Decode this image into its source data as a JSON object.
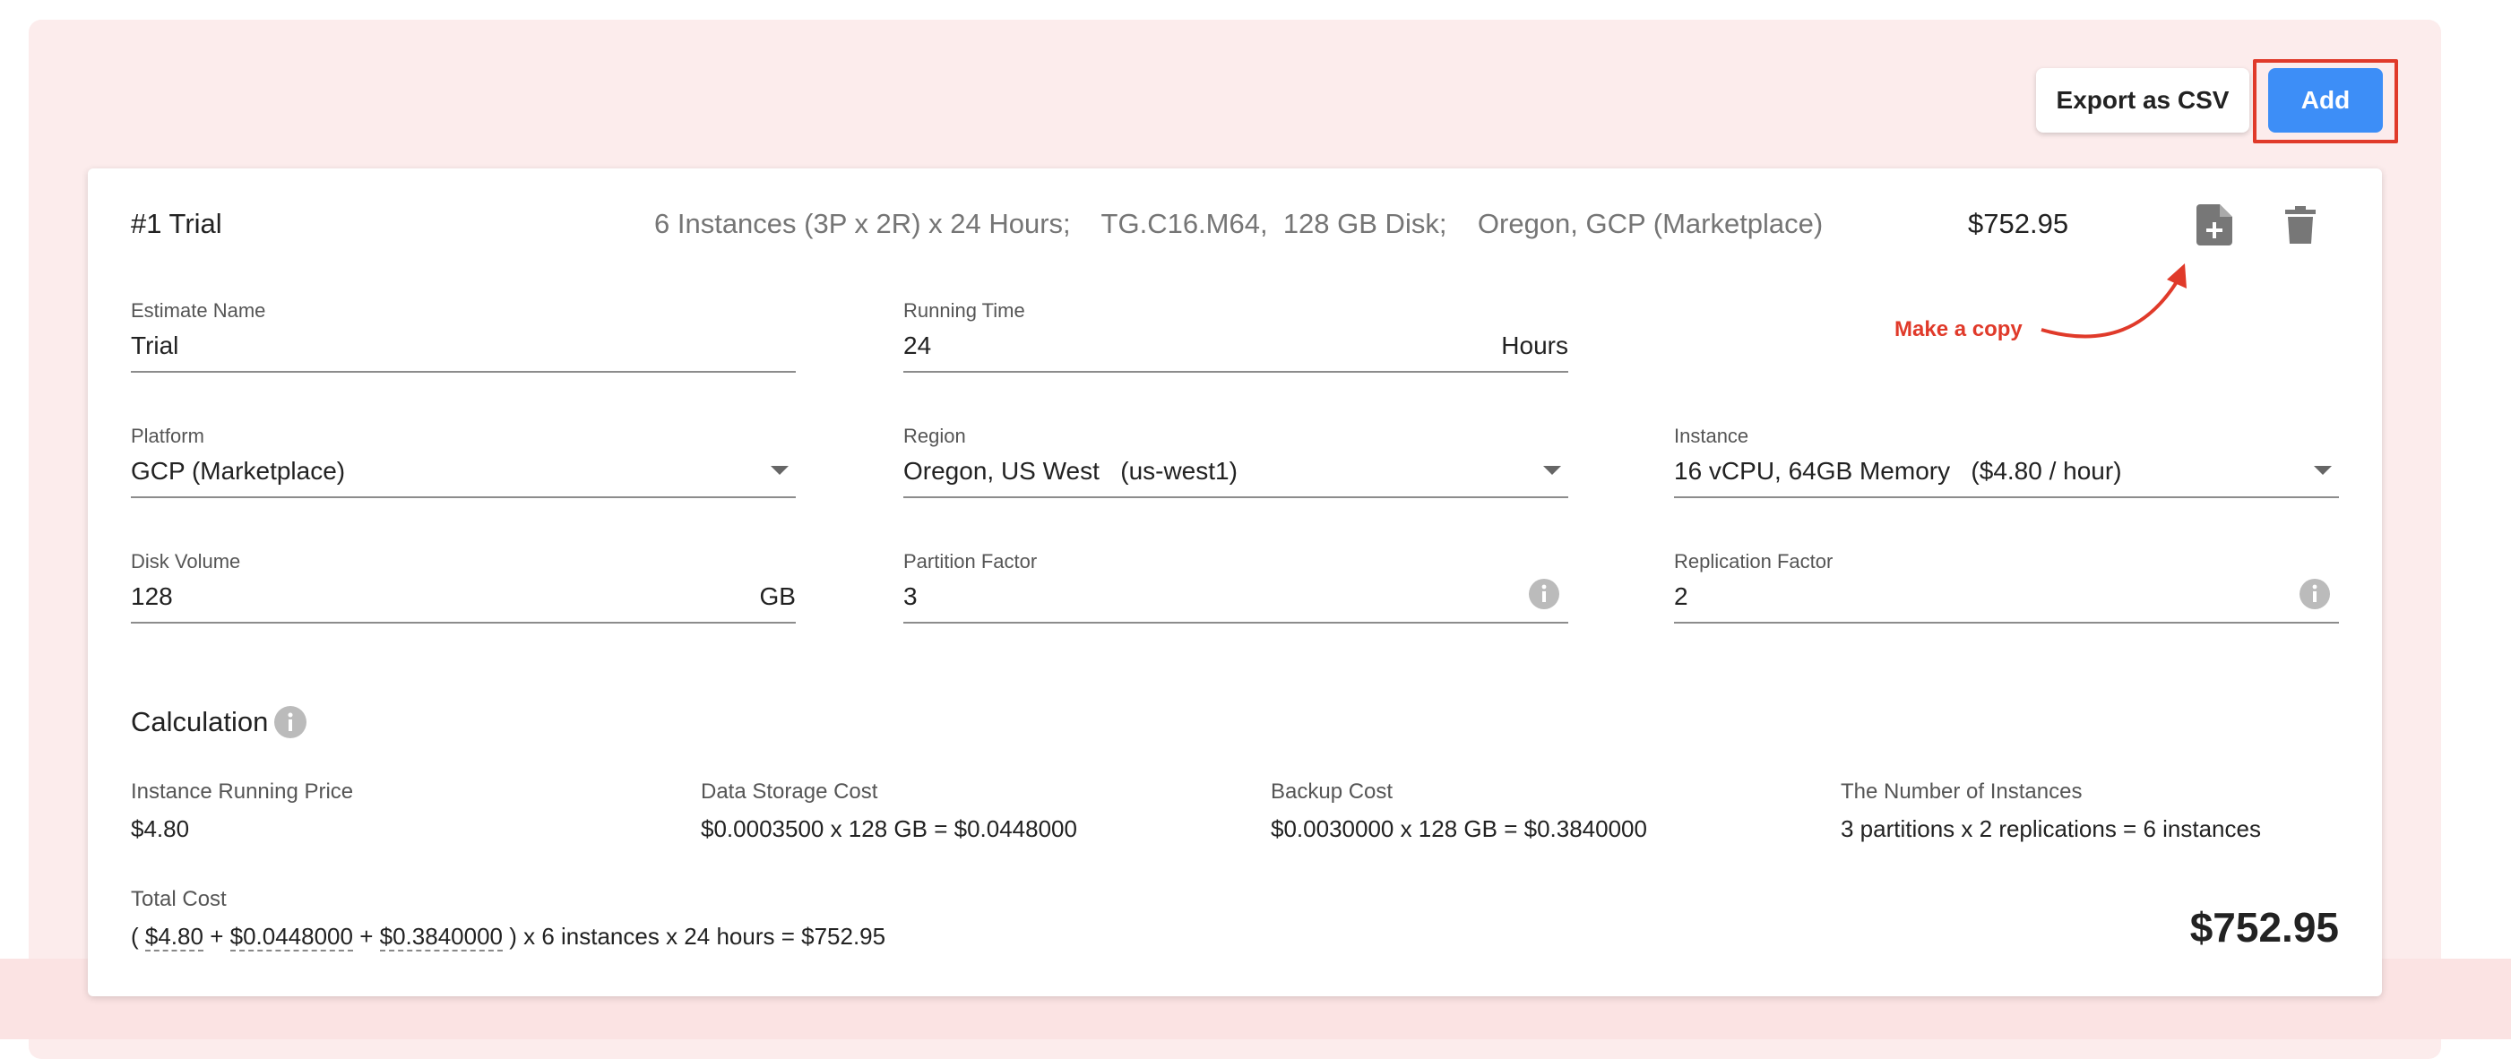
{
  "toolbar": {
    "export_label": "Export as CSV",
    "add_label": "Add",
    "add_highlight_color": "#e03a2a",
    "add_button_color": "#3d8ef7"
  },
  "estimate": {
    "title": "#1 Trial",
    "summary": "6 Instances (3P x 2R) x 24 Hours;    TG.C16.M64,  128 GB Disk;    Oregon, GCP (Marketplace)",
    "price": "$752.95",
    "copy_icon": "file-plus-icon",
    "delete_icon": "trash-icon"
  },
  "annotation": {
    "text": "Make a copy",
    "color": "#e03a2a"
  },
  "form": {
    "estimate_name": {
      "label": "Estimate Name",
      "value": "Trial"
    },
    "running_time": {
      "label": "Running Time",
      "value": "24",
      "suffix": "Hours"
    },
    "platform": {
      "label": "Platform",
      "value": "GCP (Marketplace)"
    },
    "region": {
      "label": "Region",
      "value": "Oregon, US West   (us-west1)"
    },
    "instance": {
      "label": "Instance",
      "value": "16 vCPU, 64GB Memory   ($4.80 / hour)"
    },
    "disk_volume": {
      "label": "Disk Volume",
      "value": "128",
      "suffix": "GB"
    },
    "partition_factor": {
      "label": "Partition Factor",
      "value": "3"
    },
    "replication_factor": {
      "label": "Replication Factor",
      "value": "2"
    }
  },
  "calculation": {
    "title": "Calculation",
    "instance_price": {
      "label": "Instance Running Price",
      "value": "$4.80"
    },
    "storage_cost": {
      "label": "Data Storage Cost",
      "value": "$0.0003500 x 128 GB = $0.0448000"
    },
    "backup_cost": {
      "label": "Backup Cost",
      "value": "$0.0030000 x 128 GB = $0.3840000"
    },
    "num_instances": {
      "label": "The Number of Instances",
      "value": "3 partitions x 2 replications = 6 instances"
    },
    "total": {
      "label": "Total Cost",
      "open": "( ",
      "term1": "$4.80",
      "plus1": " + ",
      "term2": "$0.0448000",
      "plus2": " + ",
      "term3": "$0.3840000",
      "rest": " ) x 6 instances x 24 hours = $752.95",
      "big": "$752.95"
    }
  }
}
